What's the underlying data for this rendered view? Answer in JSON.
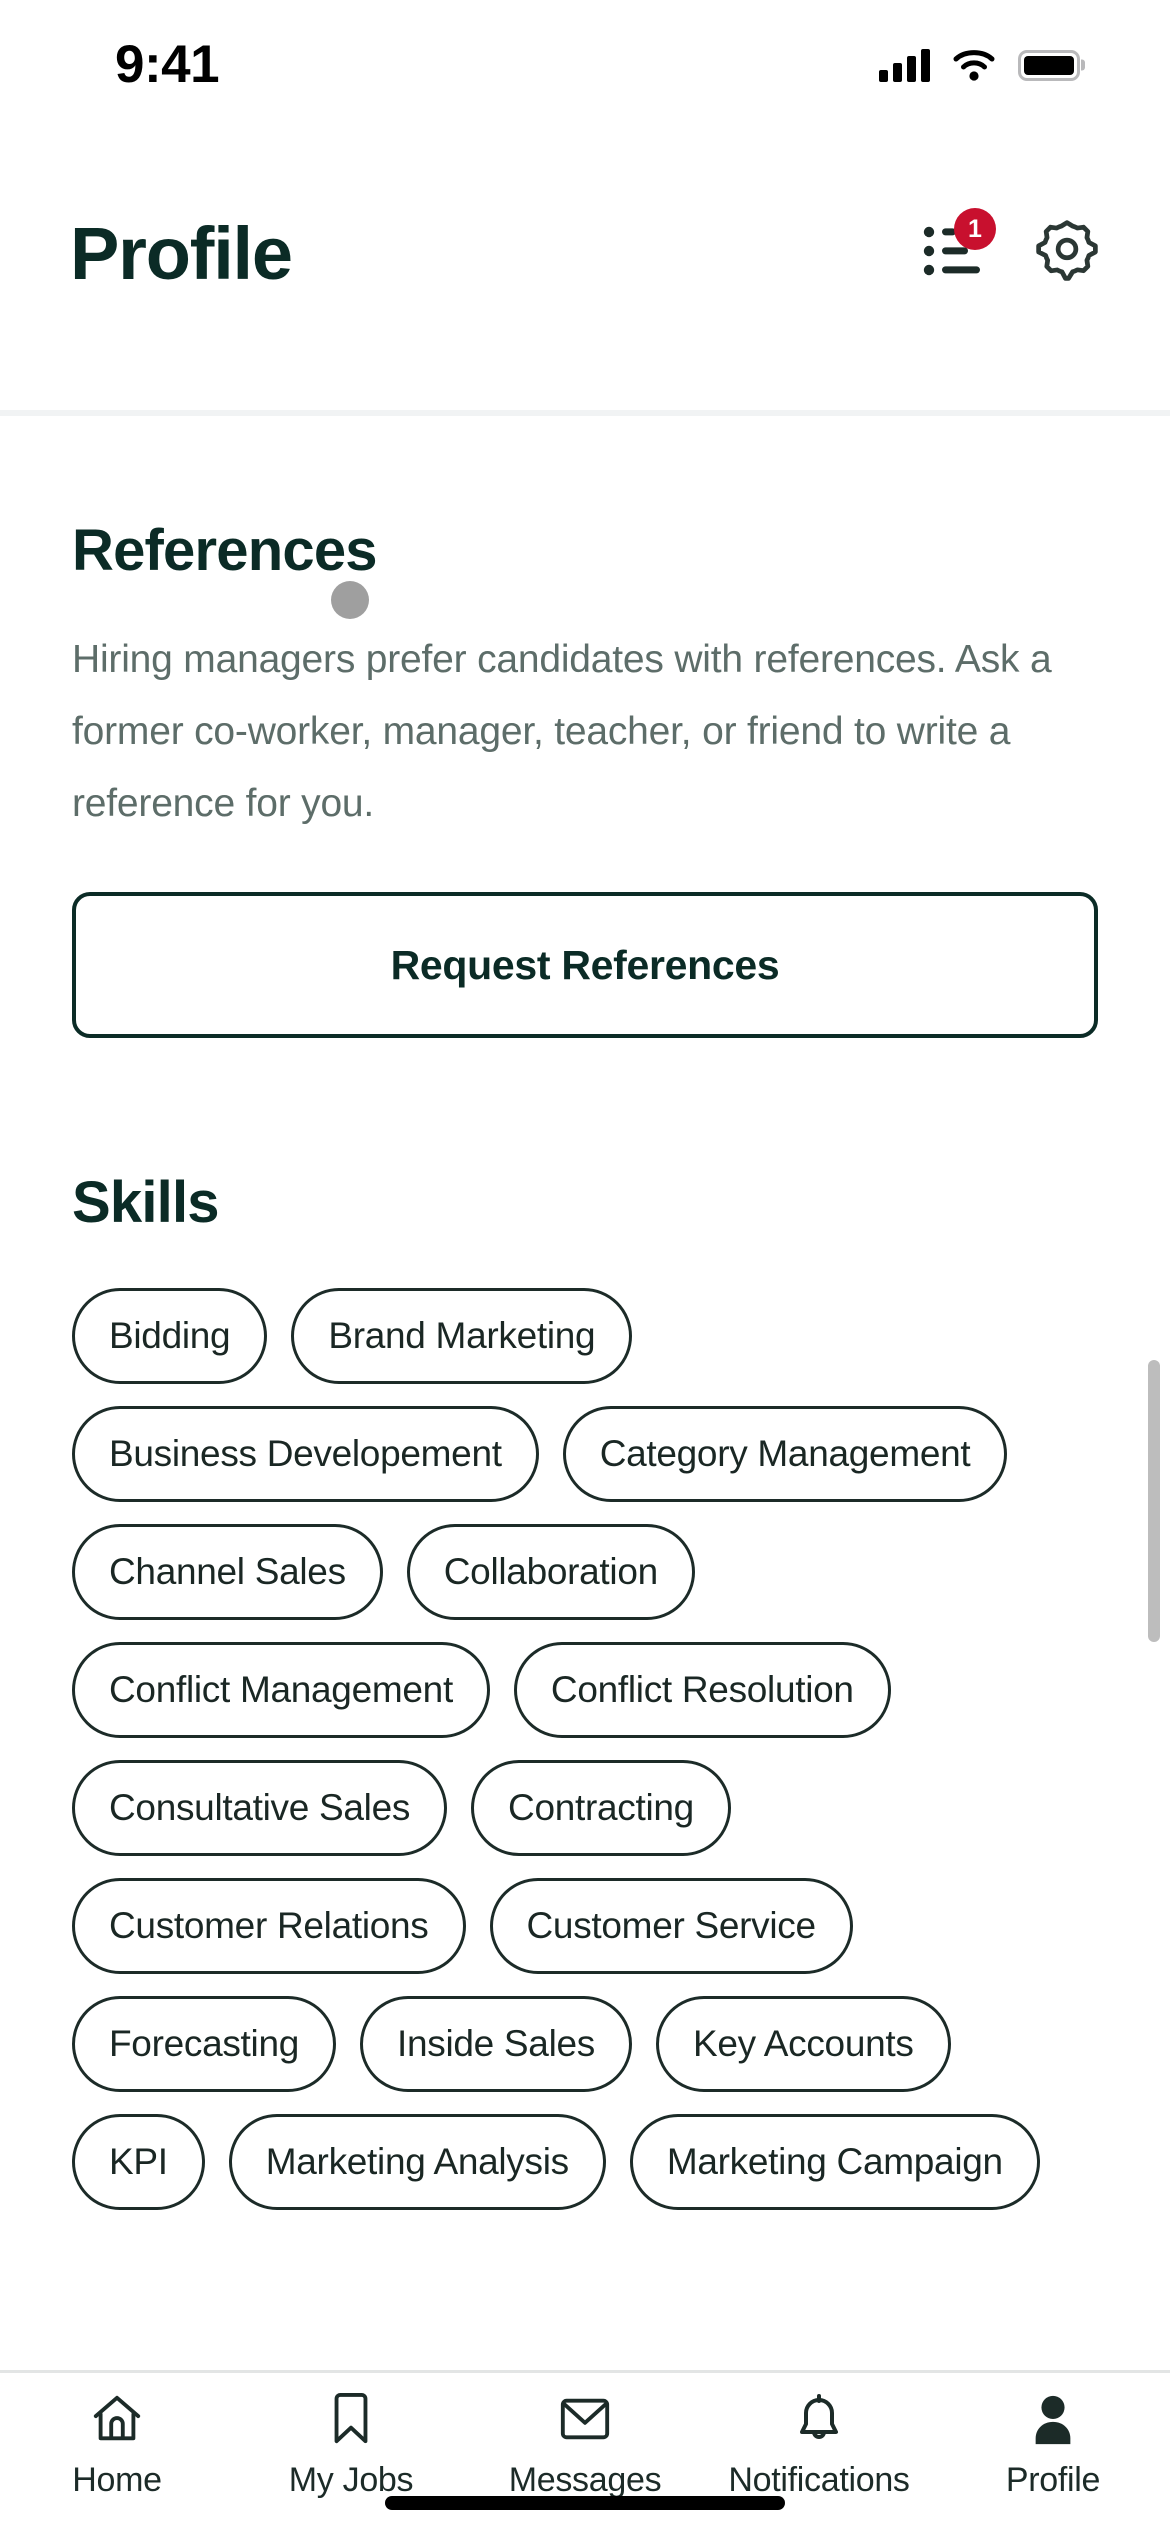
{
  "status_bar": {
    "time": "9:41",
    "cellular_icon": "cellular-bars-icon",
    "wifi_icon": "wifi-icon",
    "battery_icon": "battery-full-icon"
  },
  "header": {
    "title": "Profile",
    "checklist_icon": "checklist-icon",
    "checklist_badge": "1",
    "settings_icon": "gear-icon"
  },
  "references": {
    "title": "References",
    "body": "Hiring managers prefer candidates with references. Ask a former co-worker, manager, teacher, or friend to write a reference for you.",
    "button_label": "Request References"
  },
  "skills": {
    "title": "Skills",
    "chips": [
      "Bidding",
      "Brand Marketing",
      "Business Developement",
      "Category Management",
      "Channel Sales",
      "Collaboration",
      "Conflict Management",
      "Conflict Resolution",
      "Consultative Sales",
      "Contracting",
      "Customer Relations",
      "Customer Service",
      "Forecasting",
      "Inside Sales",
      "Key Accounts",
      "KPI",
      "Marketing Analysis",
      "Marketing Campaign"
    ]
  },
  "tab_bar": {
    "tabs": [
      {
        "label": "Home",
        "icon": "home-icon",
        "active": false
      },
      {
        "label": "My Jobs",
        "icon": "bookmark-icon",
        "active": false
      },
      {
        "label": "Messages",
        "icon": "envelope-icon",
        "active": false
      },
      {
        "label": "Notifications",
        "icon": "bell-icon",
        "active": false
      },
      {
        "label": "Profile",
        "icon": "person-icon",
        "active": true
      }
    ]
  },
  "colors": {
    "brand_dark_green": "#0b2b26",
    "badge_red": "#c8102e",
    "body_gray": "#5d6d69"
  }
}
